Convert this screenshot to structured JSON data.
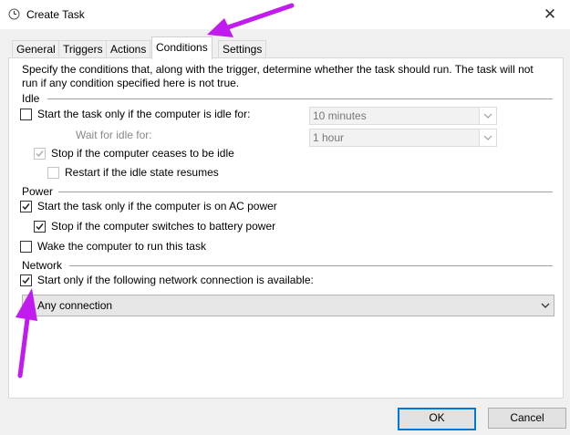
{
  "window": {
    "title": "Create Task",
    "close_glyph": "✕"
  },
  "tabs": [
    {
      "label": "General"
    },
    {
      "label": "Triggers"
    },
    {
      "label": "Actions"
    },
    {
      "label": "Conditions"
    },
    {
      "label": "Settings"
    }
  ],
  "active_tab": "Conditions",
  "description": "Specify the conditions that, along with the trigger, determine whether the task should run.  The task will not run  if any condition specified here is not true.",
  "idle": {
    "group": "Idle",
    "start_only_idle": {
      "label": "Start the task only if the computer is idle for:",
      "checked": false
    },
    "idle_duration": "10 minutes",
    "wait_for_idle_label": "Wait for idle for:",
    "wait_duration": "1 hour",
    "stop_if_not_idle": {
      "label": "Stop if the computer ceases to be idle",
      "checked": true,
      "enabled": false
    },
    "restart_if_idle_resumes": {
      "label": "Restart if the idle state resumes",
      "checked": false,
      "enabled": false
    }
  },
  "power": {
    "group": "Power",
    "ac_power": {
      "label": "Start the task only if the computer is on AC power",
      "checked": true
    },
    "stop_on_battery": {
      "label": "Stop if the computer switches to battery power",
      "checked": true
    },
    "wake": {
      "label": "Wake the computer to run this task",
      "checked": false
    }
  },
  "network": {
    "group": "Network",
    "start_if_network": {
      "label": "Start only if the following network connection is available:",
      "checked": true
    },
    "connection": "Any connection"
  },
  "buttons": {
    "ok": "OK",
    "cancel": "Cancel"
  },
  "annotation_color": "#c21bf0"
}
